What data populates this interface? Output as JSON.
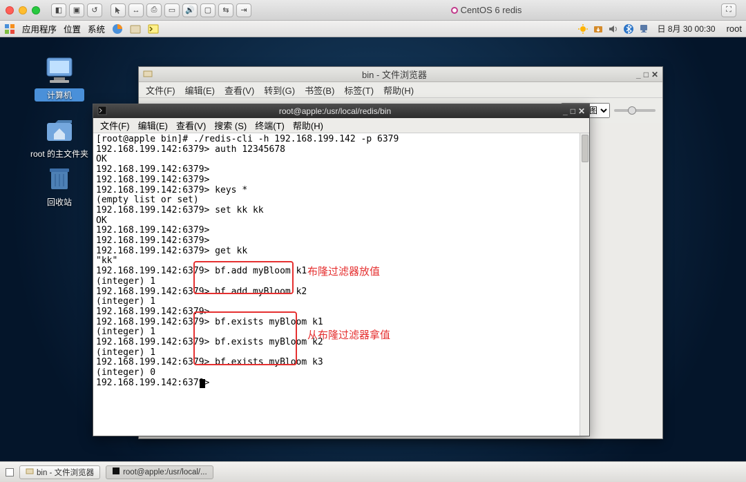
{
  "mac": {
    "vm_title": "CentOS 6 redis"
  },
  "gnome": {
    "apps": "应用程序",
    "places": "位置",
    "system": "系统",
    "date": "日 8月 30 00:30",
    "user": "root"
  },
  "desktop_icons": {
    "computer": "计算机",
    "home": "root 的主文件夹",
    "trash": "回收站"
  },
  "nautilus": {
    "title": "bin - 文件浏览器",
    "menus": {
      "file": "文件(F)",
      "edit": "编辑(E)",
      "view": "查看(V)",
      "go": "转到(G)",
      "bookmarks": "书签(B)",
      "tabs": "标签(T)",
      "help": "帮助(H)"
    },
    "view_label": "图标视图"
  },
  "terminal": {
    "title": "root@apple:/usr/local/redis/bin",
    "menus": {
      "file": "文件(F)",
      "edit": "编辑(E)",
      "view": "查看(V)",
      "search": "搜索 (S)",
      "terminal": "终端(T)",
      "help": "帮助(H)"
    },
    "lines": [
      "[root@apple bin]# ./redis-cli -h 192.168.199.142 -p 6379",
      "192.168.199.142:6379> auth 12345678",
      "OK",
      "192.168.199.142:6379>",
      "192.168.199.142:6379>",
      "192.168.199.142:6379> keys *",
      "(empty list or set)",
      "192.168.199.142:6379> set kk kk",
      "OK",
      "192.168.199.142:6379>",
      "192.168.199.142:6379>",
      "192.168.199.142:6379> get kk",
      "\"kk\"",
      "192.168.199.142:6379> bf.add myBloom k1",
      "(integer) 1",
      "192.168.199.142:6379> bf.add myBloom k2",
      "(integer) 1",
      "192.168.199.142:6379>",
      "192.168.199.142:6379> bf.exists myBloom k1",
      "(integer) 1",
      "192.168.199.142:6379> bf.exists myBloom k2",
      "(integer) 1",
      "192.168.199.142:6379> bf.exists myBloom k3",
      "(integer) 0",
      "192.168.199.142:6379> "
    ]
  },
  "annotations": {
    "put_label": "布隆过滤器放值",
    "get_label": "从布隆过滤器拿值"
  },
  "taskbar": {
    "item1": "bin - 文件浏览器",
    "item2": "root@apple:/usr/local/..."
  }
}
